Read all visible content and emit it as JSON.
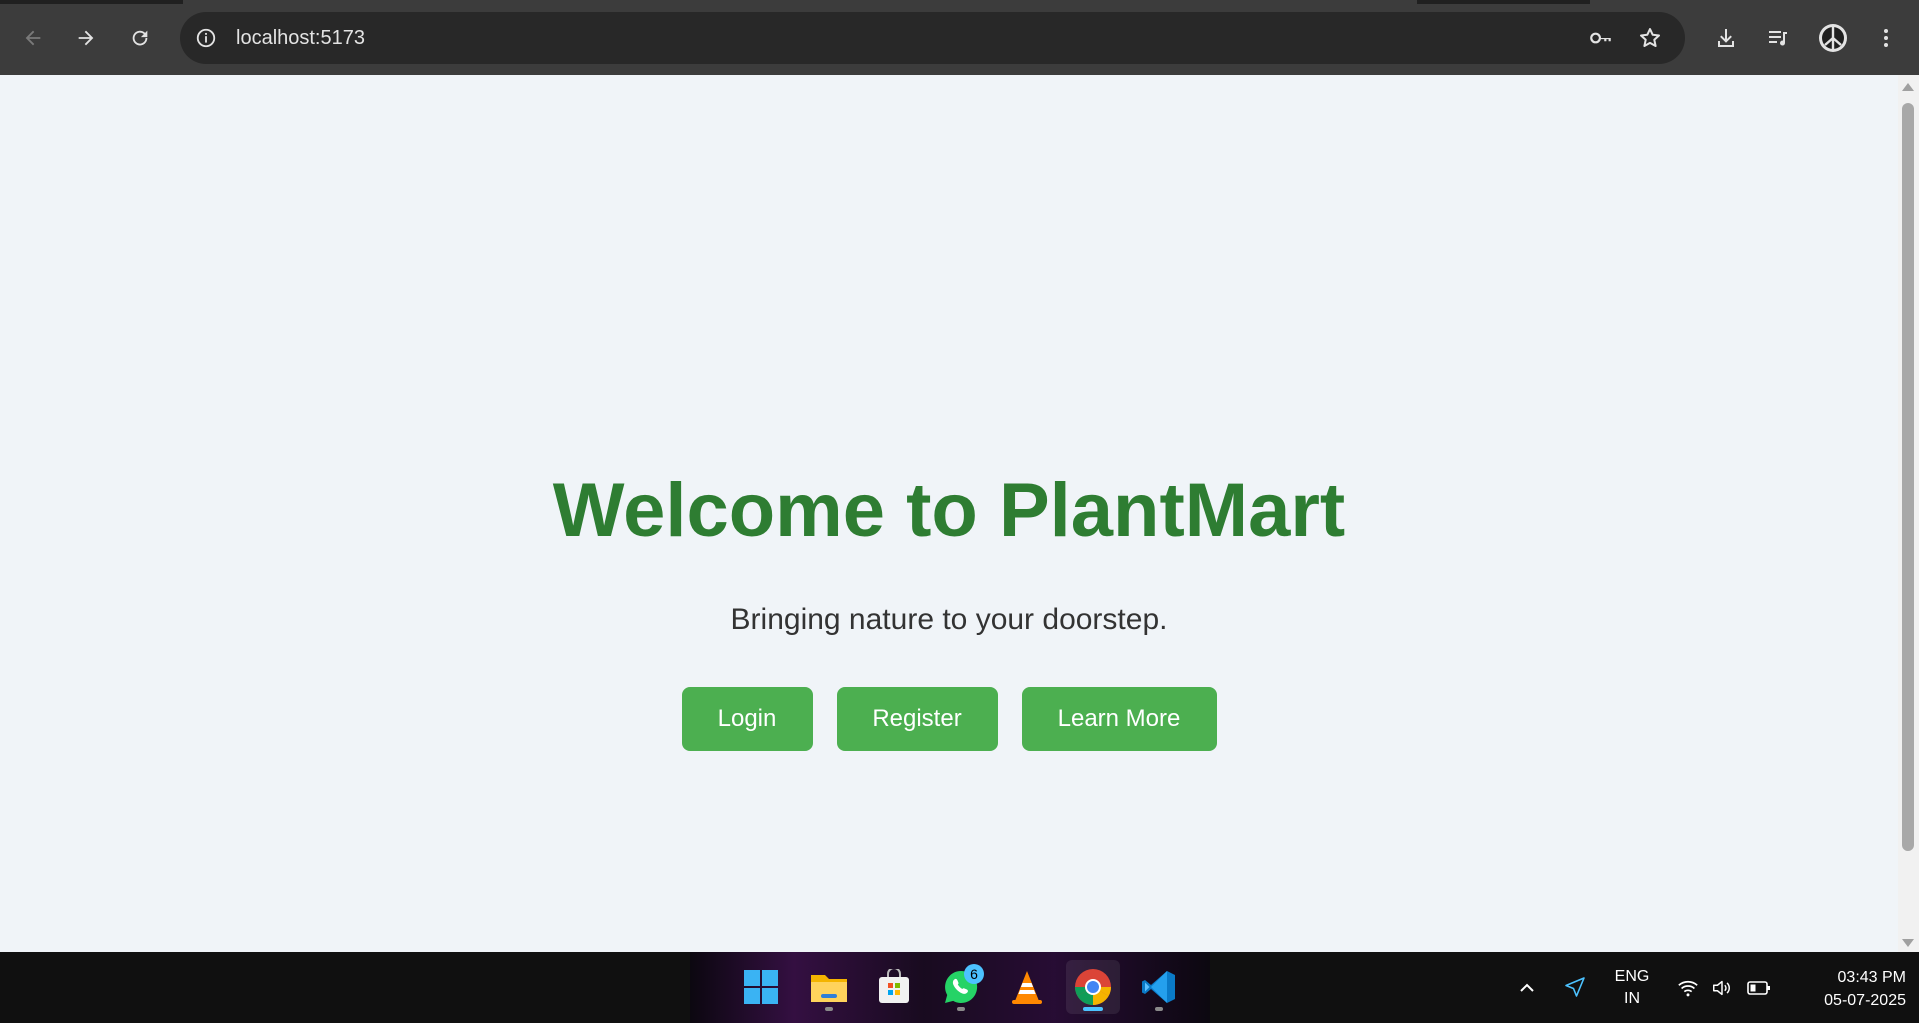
{
  "browser": {
    "url": "localhost:5173",
    "icons": {
      "back": "back-arrow-icon",
      "forward": "forward-arrow-icon",
      "reload": "reload-icon",
      "site_info": "info-icon",
      "password": "key-icon",
      "bookmark": "star-icon",
      "downloads": "download-icon",
      "media": "media-control-icon",
      "profile": "profile-icon",
      "menu": "kebab-menu-icon"
    }
  },
  "page": {
    "title": "Welcome to PlantMart",
    "tagline": "Bringing nature to your doorstep.",
    "buttons": {
      "login": "Login",
      "register": "Register",
      "learn_more": "Learn More"
    },
    "colors": {
      "title": "#2e7d32",
      "button": "#4caf50",
      "background": "#f0f4f8"
    }
  },
  "taskbar": {
    "apps": [
      {
        "name": "windows-start",
        "icon": "windows-logo-icon"
      },
      {
        "name": "file-explorer",
        "icon": "folder-icon"
      },
      {
        "name": "microsoft-store",
        "icon": "store-icon"
      },
      {
        "name": "whatsapp",
        "icon": "whatsapp-icon",
        "badge": "6"
      },
      {
        "name": "vlc",
        "icon": "vlc-cone-icon"
      },
      {
        "name": "chrome",
        "icon": "chrome-icon",
        "active": true
      },
      {
        "name": "vscode",
        "icon": "vscode-icon"
      }
    ],
    "tray": {
      "lang_line1": "ENG",
      "lang_line2": "IN",
      "time": "03:43 PM",
      "date": "05-07-2025"
    }
  }
}
